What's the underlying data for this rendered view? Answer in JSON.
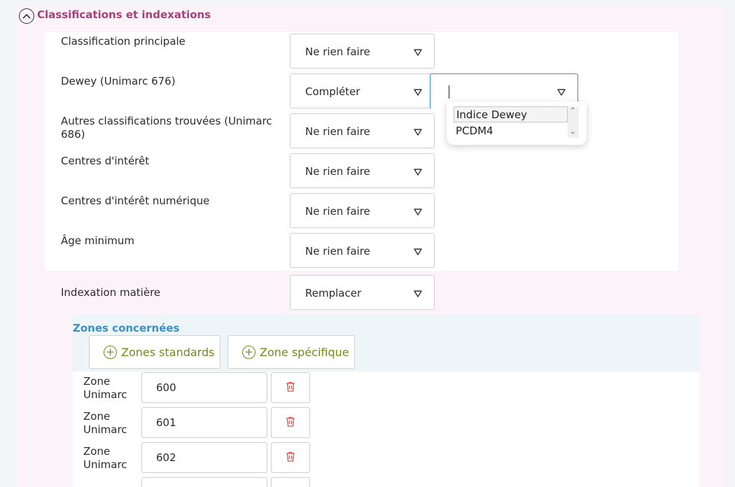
{
  "section": {
    "title": "Classifications et indexations",
    "toggle_icon": "chevron-up-circle-icon",
    "accent_color": "#a8407e"
  },
  "rows": [
    {
      "label": "Classification principale",
      "value": "Ne rien faire"
    },
    {
      "label": "Dewey (Unimarc 676)",
      "value": "Compléter"
    },
    {
      "label": "Autres classifications trouvées (Unimarc 686)",
      "value": "Ne rien faire"
    },
    {
      "label": "Centres d'intérêt",
      "value": "Ne rien faire"
    },
    {
      "label": "Centres d'intérêt numérique",
      "value": "Ne rien faire"
    },
    {
      "label": "Âge minimum",
      "value": "Ne rien faire"
    }
  ],
  "dewey_target": {
    "value": "",
    "options": [
      "Indice Dewey",
      "PCDM4"
    ],
    "focus_color": "#3d8fc4"
  },
  "indexation": {
    "label": "Indexation matière",
    "value": "Remplacer"
  },
  "zones": {
    "title": "Zones concernées",
    "title_color": "#3d8fc4",
    "add_standard_label": "Zones standards",
    "add_specific_label": "Zone spécifique",
    "button_color": "#6f8b1a",
    "delete_color": "#d9534f",
    "items": [
      {
        "label": "Zone Unimarc",
        "value": "600"
      },
      {
        "label": "Zone Unimarc",
        "value": "601"
      },
      {
        "label": "Zone Unimarc",
        "value": "602"
      }
    ]
  }
}
